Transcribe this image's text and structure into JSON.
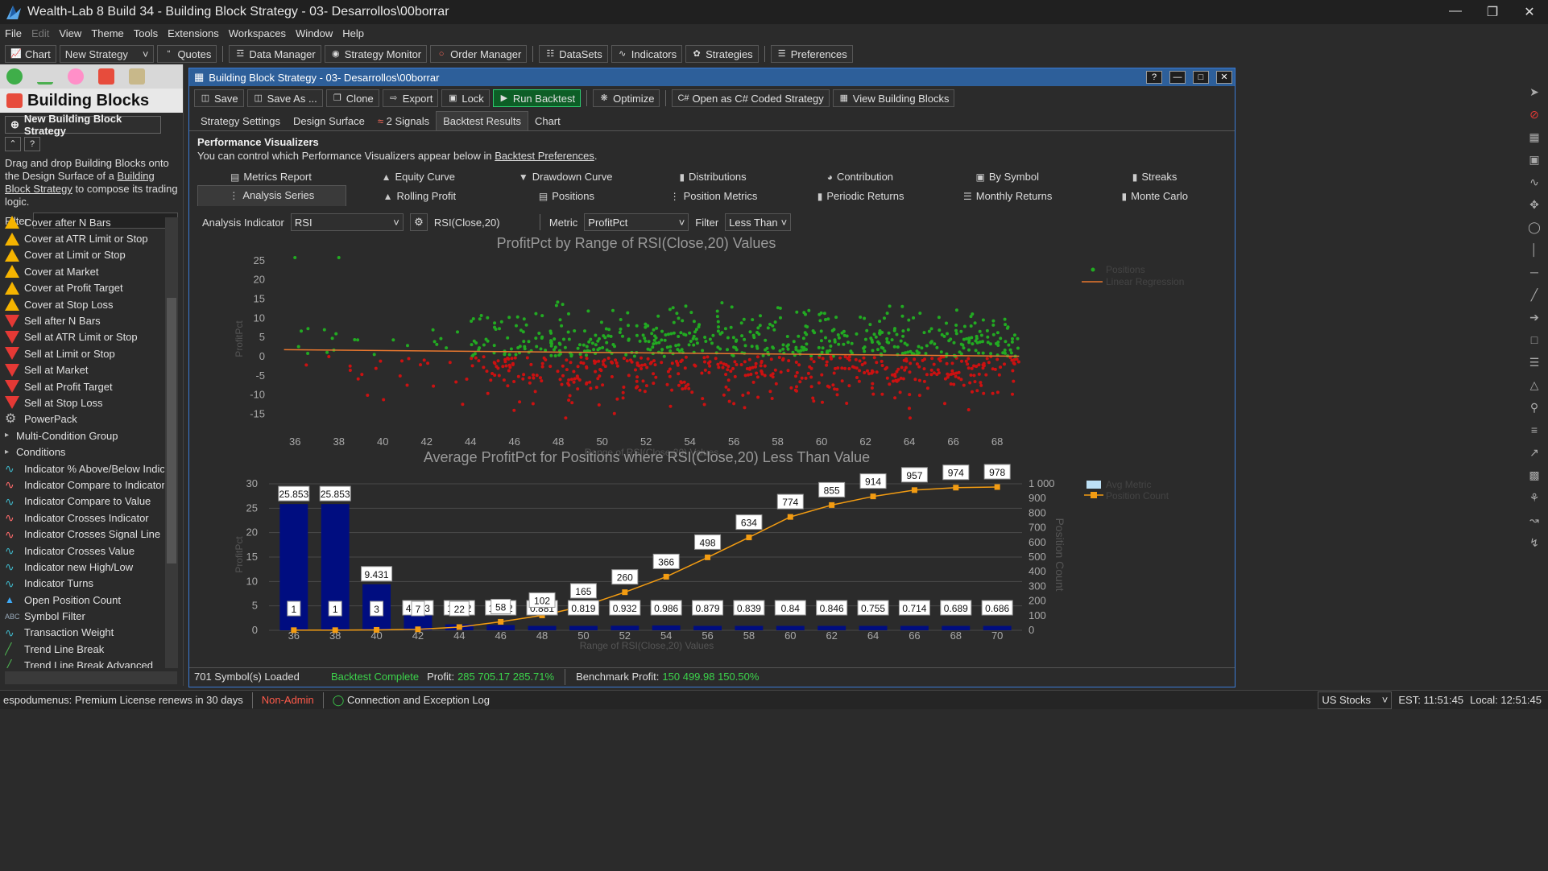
{
  "window": {
    "title": "Wealth-Lab 8 Build 34 - Building Block Strategy - 03- Desarrollos\\00borrar"
  },
  "menu": [
    "File",
    "Edit",
    "View",
    "Theme",
    "Tools",
    "Extensions",
    "Workspaces",
    "Window",
    "Help"
  ],
  "toolbar": {
    "chart": "Chart",
    "new_strategy": "New Strategy",
    "quotes": "Quotes",
    "data_manager": "Data Manager",
    "strategy_monitor": "Strategy Monitor",
    "order_manager": "Order Manager",
    "datasets": "DataSets",
    "indicators": "Indicators",
    "strategies": "Strategies",
    "preferences": "Preferences"
  },
  "left": {
    "title": "Building Blocks",
    "new_button": "New Building Block Strategy",
    "help_text_1": "Drag and drop Building Blocks onto the Design Surface of a ",
    "help_link": "Building Block Strategy",
    "help_text_2": " to compose its trading logic.",
    "filter_label": "Filter",
    "items": [
      {
        "label": "Cover after N Bars",
        "icon": "cover"
      },
      {
        "label": "Cover at ATR Limit or Stop",
        "icon": "cover"
      },
      {
        "label": "Cover at Limit or Stop",
        "icon": "cover"
      },
      {
        "label": "Cover at Market",
        "icon": "cover"
      },
      {
        "label": "Cover at Profit Target",
        "icon": "cover"
      },
      {
        "label": "Cover at Stop Loss",
        "icon": "cover"
      },
      {
        "label": "Sell after N Bars",
        "icon": "sell"
      },
      {
        "label": "Sell at ATR Limit or Stop",
        "icon": "sell"
      },
      {
        "label": "Sell at Limit or Stop",
        "icon": "sell"
      },
      {
        "label": "Sell at Market",
        "icon": "sell"
      },
      {
        "label": "Sell at Profit Target",
        "icon": "sell"
      },
      {
        "label": "Sell at Stop Loss",
        "icon": "sell"
      },
      {
        "label": "PowerPack",
        "icon": "gear"
      },
      {
        "label": "Multi-Condition Group",
        "icon": "group"
      },
      {
        "label": "Conditions",
        "icon": "group"
      },
      {
        "label": "Indicator % Above/Below Indic",
        "icon": "wave"
      },
      {
        "label": "Indicator Compare to Indicator",
        "icon": "wave2"
      },
      {
        "label": "Indicator Compare to Value",
        "icon": "wave"
      },
      {
        "label": "Indicator Crosses Indicator",
        "icon": "wave2"
      },
      {
        "label": "Indicator Crosses Signal Line",
        "icon": "wave2"
      },
      {
        "label": "Indicator Crosses Value",
        "icon": "wave"
      },
      {
        "label": "Indicator new High/Low",
        "icon": "wave"
      },
      {
        "label": "Indicator Turns",
        "icon": "wave"
      },
      {
        "label": "Open Position Count",
        "icon": "count"
      },
      {
        "label": "Symbol Filter",
        "icon": "abc"
      },
      {
        "label": "Transaction Weight",
        "icon": "wave"
      },
      {
        "label": "Trend Line Break",
        "icon": "trend"
      },
      {
        "label": "Trend Line Break Advanced",
        "icon": "trend"
      }
    ]
  },
  "doc": {
    "title": "Building Block Strategy - 03- Desarrollos\\00borrar",
    "toolbar": {
      "save": "Save",
      "save_as": "Save As ...",
      "clone": "Clone",
      "export": "Export",
      "lock": "Lock",
      "run": "Run Backtest",
      "optimize": "Optimize",
      "open_cs": "Open as C# Coded Strategy",
      "view_bb": "View Building Blocks"
    },
    "tabs": [
      "Strategy Settings",
      "Design Surface",
      "2 Signals",
      "Backtest Results",
      "Chart"
    ],
    "pv_title": "Performance Visualizers",
    "pv_sub_1": "You can control which Performance Visualizers appear below in ",
    "pv_link": "Backtest Preferences",
    "pv_sub_2": ".",
    "viz_row1": [
      "Metrics Report",
      "Equity Curve",
      "Drawdown Curve",
      "Distributions",
      "Contribution",
      "By Symbol",
      "Streaks"
    ],
    "viz_row2": [
      "Analysis Series",
      "Rolling Profit",
      "Positions",
      "Position Metrics",
      "Periodic Returns",
      "Monthly Returns",
      "Monte Carlo"
    ],
    "analysis_label": "Analysis Indicator",
    "analysis_value": "RSI",
    "indicator_desc": "RSI(Close,20)",
    "metric_label": "Metric",
    "metric_value": "ProfitPct",
    "filter_label": "Filter",
    "filter_value": "Less Than",
    "status": {
      "symbols": "701 Symbol(s) Loaded",
      "backtest": "Backtest Complete",
      "profit_label": "Profit:",
      "profit_value": "285 705.17 285.71%",
      "bench_label": "Benchmark Profit:",
      "bench_value": "150 499.98 150.50%"
    }
  },
  "bottom": {
    "license": "espodumenus: Premium License renews in 30 days",
    "admin": "Non-Admin",
    "log": "Connection and Exception Log",
    "market": "US Stocks",
    "est": "EST: 11:51:45",
    "local": "Local: 12:51:45"
  },
  "colors": {
    "accent": "#3a7bd5",
    "profit_green": "#22aa22",
    "loss_red": "#cc1111",
    "bar_navy": "#000d80",
    "count_orange": "#f39c12"
  },
  "chart_data": [
    {
      "type": "scatter",
      "title": "ProfitPct by Range of RSI(Close,20) Values",
      "xlabel": "Range of RSI(Close,20) Values",
      "ylabel": "ProfitPct",
      "xlim": [
        35,
        69.5
      ],
      "ylim": [
        -17,
        26
      ],
      "xticks": [
        36,
        38,
        40,
        42,
        44,
        46,
        48,
        50,
        52,
        54,
        56,
        58,
        60,
        62,
        64,
        66,
        68
      ],
      "yticks": [
        25,
        20,
        15,
        10,
        5,
        0,
        -5,
        -10,
        -15
      ],
      "legend": [
        "Positions",
        "Linear Regression"
      ],
      "legend_position": "top-right",
      "regression": {
        "x": [
          35.5,
          69
        ],
        "y": [
          1.8,
          0.1
        ]
      },
      "density_note_values": {
        "x_min": 36,
        "x_max": 69,
        "dense_from": 44,
        "dense_to": 66
      }
    },
    {
      "type": "bar",
      "title": "Average ProfitPct for Positions where RSI(Close,20) Less Than Value",
      "xlabel": "Range of RSI(Close,20) Values",
      "ylabel": "ProfitPct",
      "y2label": "Position Count",
      "categories": [
        36,
        38,
        40,
        42,
        44,
        46,
        48,
        50,
        52,
        54,
        56,
        58,
        60,
        62,
        64,
        66,
        68,
        70
      ],
      "series": [
        {
          "name": "Avg Metric",
          "values": [
            25.853,
            25.853,
            9.431,
            4.483,
            1.222,
            1.082,
            0.881,
            0.819,
            0.932,
            0.986,
            0.879,
            0.839,
            0.84,
            0.846,
            0.755,
            0.714,
            0.689,
            0.686
          ]
        },
        {
          "name": "Position Count",
          "values": [
            1,
            1,
            3,
            7,
            22,
            58,
            102,
            165,
            260,
            366,
            498,
            634,
            774,
            855,
            914,
            957,
            974,
            978
          ]
        }
      ],
      "value_labels": [
        "25.853",
        "25.853",
        "9.431",
        "4.483",
        "1.222",
        "1.082",
        "0.881",
        "0.819",
        "0.932",
        "0.986",
        "0.879",
        "0.839",
        "0.84",
        "0.846",
        "0.755",
        "0.714",
        "0.689",
        "0.686"
      ],
      "count_labels": [
        "1",
        "1",
        "3",
        "7",
        "22",
        "58",
        "102",
        "165",
        "260",
        "366",
        "498",
        "634",
        "774",
        "855",
        "914",
        "957",
        "974",
        "978"
      ],
      "ylim": [
        0,
        30
      ],
      "y2lim": [
        0,
        1000
      ],
      "yticks": [
        0,
        5,
        10,
        15,
        20,
        25,
        30
      ],
      "y2ticks": [
        "0",
        "100",
        "200",
        "300",
        "400",
        "500",
        "600",
        "700",
        "800",
        "900",
        "1 000"
      ],
      "legend_position": "top-right"
    }
  ]
}
